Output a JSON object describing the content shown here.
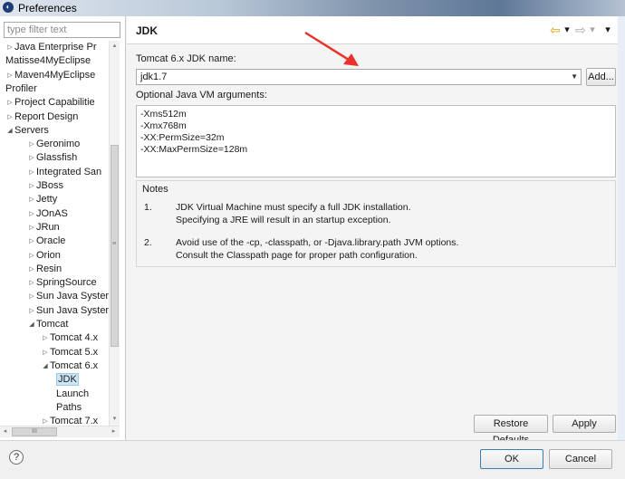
{
  "window": {
    "title": "Preferences",
    "app_icon": "eclipse-icon"
  },
  "sidebar": {
    "filter_placeholder": "type filter text",
    "items": [
      {
        "label": "Java Enterprise Pr",
        "toggle": "▷",
        "indent": 0
      },
      {
        "label": "Matisse4MyEclipse",
        "toggle": "",
        "indent": 0
      },
      {
        "label": "Maven4MyEclipse",
        "toggle": "▷",
        "indent": 0
      },
      {
        "label": "Profiler",
        "toggle": "",
        "indent": 0
      },
      {
        "label": "Project Capabilitie",
        "toggle": "▷",
        "indent": 0
      },
      {
        "label": "Report Design",
        "toggle": "▷",
        "indent": 0
      },
      {
        "label": "Servers",
        "toggle": "◢",
        "indent": 0
      },
      {
        "label": "Geronimo",
        "toggle": "▷",
        "indent": 1
      },
      {
        "label": "Glassfish",
        "toggle": "▷",
        "indent": 1
      },
      {
        "label": "Integrated San",
        "toggle": "▷",
        "indent": 1
      },
      {
        "label": "JBoss",
        "toggle": "▷",
        "indent": 1
      },
      {
        "label": "Jetty",
        "toggle": "▷",
        "indent": 1
      },
      {
        "label": "JOnAS",
        "toggle": "▷",
        "indent": 1
      },
      {
        "label": "JRun",
        "toggle": "▷",
        "indent": 1
      },
      {
        "label": "Oracle",
        "toggle": "▷",
        "indent": 1
      },
      {
        "label": "Orion",
        "toggle": "▷",
        "indent": 1
      },
      {
        "label": "Resin",
        "toggle": "▷",
        "indent": 1
      },
      {
        "label": "SpringSource",
        "toggle": "▷",
        "indent": 1
      },
      {
        "label": "Sun Java Syster",
        "toggle": "▷",
        "indent": 1
      },
      {
        "label": "Sun Java Syster",
        "toggle": "▷",
        "indent": 1
      },
      {
        "label": "Tomcat",
        "toggle": "◢",
        "indent": 1
      },
      {
        "label": "Tomcat  4.x",
        "toggle": "▷",
        "indent": 2
      },
      {
        "label": "Tomcat  5.x",
        "toggle": "▷",
        "indent": 2
      },
      {
        "label": "Tomcat  6.x",
        "toggle": "◢",
        "indent": 2
      },
      {
        "label": "JDK",
        "toggle": "",
        "indent": 3,
        "selected": true
      },
      {
        "label": "Launch",
        "toggle": "",
        "indent": 3
      },
      {
        "label": "Paths",
        "toggle": "",
        "indent": 3
      },
      {
        "label": "Tomcat  7.x",
        "toggle": "▷",
        "indent": 2
      }
    ],
    "hscroll_grip": "III",
    "vscroll_grip": "≡"
  },
  "page": {
    "title": "JDK",
    "nav": {
      "back": "⇦",
      "dropdown": "▾",
      "forward": "⇨",
      "menu": "▾"
    },
    "jdk_name_label": "Tomcat  6.x JDK name:",
    "jdk_name_value": "jdk1.7",
    "add_button": "Add...",
    "vm_args_label": "Optional Java VM arguments:",
    "vm_args": [
      "-Xms512m",
      "-Xmx768m",
      "-XX:PermSize=32m",
      "-XX:MaxPermSize=128m"
    ],
    "notes_title": "Notes",
    "notes": [
      {
        "number": "1.",
        "lines": [
          "JDK Virtual Machine must specify a full JDK installation.",
          "Specifying a JRE will result in an startup exception."
        ]
      },
      {
        "number": "2.",
        "lines": [
          "Avoid use of the -cp, -classpath, or -Djava.library.path JVM options.",
          "Consult the Classpath page for proper path configuration."
        ]
      }
    ],
    "restore_defaults_button": "Restore Defaults",
    "apply_button": "Apply",
    "annotation_color": "#e8322b"
  },
  "footer": {
    "help_icon": "?",
    "ok_button": "OK",
    "cancel_button": "Cancel"
  }
}
